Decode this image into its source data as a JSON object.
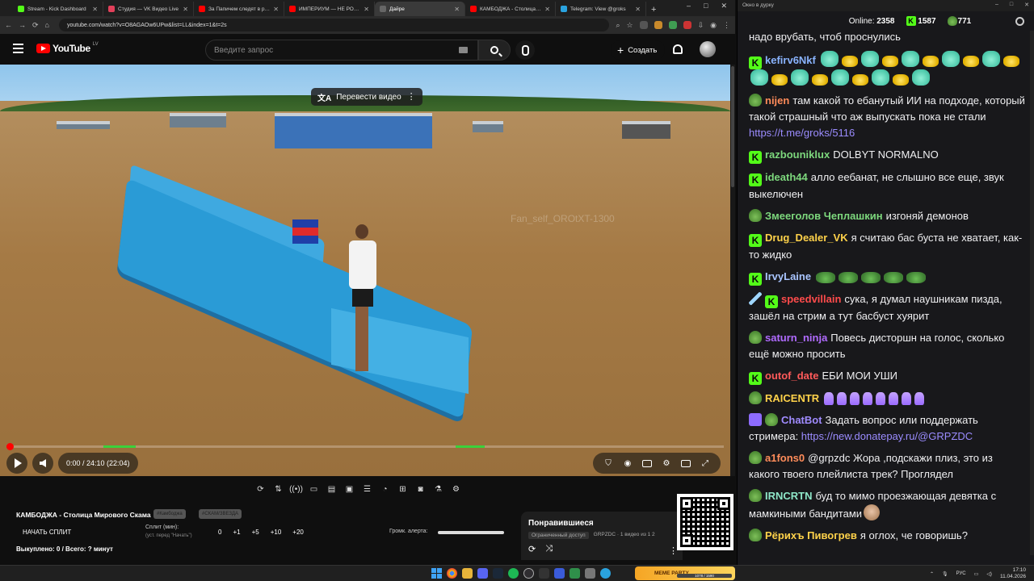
{
  "browser": {
    "tabs": [
      {
        "title": "Stream - Kick Dashboard",
        "color": "#53fc18",
        "active": false
      },
      {
        "title": "Студия — VK Видео Live",
        "color": "#e2405a",
        "active": false
      },
      {
        "title": "За Папичем следят в реальн...",
        "color": "#ff0000",
        "active": false
      },
      {
        "title": "ИМПЕРИУМ — НЕ РОССИЯ",
        "color": "#ff0000",
        "active": false
      },
      {
        "title": "Дайре",
        "color": "#666666",
        "active": true
      },
      {
        "title": "КАМБОДЖА - Столица Мир...",
        "color": "#ff0000",
        "active": false
      },
      {
        "title": "Telegram: View @groks",
        "color": "#2aa3df",
        "active": false
      }
    ],
    "url": "youtube.com/watch?v=O8AGAOw6UPw&list=LL&index=1&t=2s",
    "window_controls": {
      "minimize": "–",
      "maximize": "□",
      "close": "✕"
    }
  },
  "youtube": {
    "logo_text": "YouTube",
    "region": "LV",
    "search_placeholder": "Введите запрос",
    "create_label": "Создать",
    "translate_label": "Перевести видео",
    "watermark": "Fan_self_OROtXT-1300",
    "player": {
      "time": "0:00 / 24:10 (22:04)",
      "progress_fraction": 0.0
    }
  },
  "below": {
    "video_title": "КАМБОДЖА - Столица Мирового Скама",
    "tags": [
      "#Камбоджа",
      "#СКАМ/ЗВЕЗДА"
    ],
    "split_button": "НАЧАТЬ СПЛИТ",
    "split_label": "Сплит (мин):",
    "split_hint": "(уст. перед \"Начать\")",
    "split_values": [
      "0",
      "+1",
      "+5",
      "+10",
      "+20"
    ],
    "alert_label": "Громк. алерта:",
    "bought": "Выкуплено: 0 / Всего: ? минут",
    "playlist": {
      "title": "Понравившиеся",
      "access": "Ограниченный доступ",
      "meta": "GRPZDC · 1 видео из 1 2"
    }
  },
  "chat": {
    "window_title": "Окно в дурку",
    "online_label": "Online:",
    "online_count": "2358",
    "kick_count": "1587",
    "other_count": "771",
    "messages": [
      {
        "user": "",
        "color": "#efeff1",
        "badges": [],
        "text": "надо врубать, чтоб проснулись"
      },
      {
        "user": "kefirv6Nkf",
        "color": "#8ab4ff",
        "badges": [
          "k"
        ],
        "text": "",
        "emotes": "kefir"
      },
      {
        "user": "nijen",
        "color": "#ff8c5a",
        "badges": [
          "frog"
        ],
        "text": "там какой то ебанутый ИИ на подходе, который такой страшный что аж выпускать пока не стали ",
        "link": "https://t.me/groks/5116"
      },
      {
        "user": "razbouniklux",
        "color": "#7dd87d",
        "badges": [
          "k"
        ],
        "text": "DOLBYT NORMALNO"
      },
      {
        "user": "ideath44",
        "color": "#7dd87d",
        "badges": [
          "k"
        ],
        "text": "алло еебанат, не слышно все еще, звук выкелючен"
      },
      {
        "user": "Змееголов Чеплашкин",
        "color": "#7dd87d",
        "badges": [
          "frog"
        ],
        "text": "изгоняй демонов"
      },
      {
        "user": "Drug_Dealer_VK",
        "color": "#ffd24a",
        "badges": [
          "k"
        ],
        "text": "я считаю бас буста не хватает, как-то жидко"
      },
      {
        "user": "IrvyLaine",
        "color": "#a9c5ff",
        "badges": [
          "k"
        ],
        "text": "",
        "emotes": "frogs"
      },
      {
        "user": "speedvillain",
        "color": "#ff4b4b",
        "badges": [
          "sword",
          "k"
        ],
        "text": "сука, я думал наушникам пизда, зашёл на стрим а тут басбуст хуярит"
      },
      {
        "user": "saturn_ninja",
        "color": "#b06bff",
        "badges": [
          "frog"
        ],
        "text": "Повесь дисторшн на голос, сколько ещё можно просить"
      },
      {
        "user": "outof_date",
        "color": "#ff5a5a",
        "badges": [
          "k"
        ],
        "text": "ЕБИ МОИ УШИ"
      },
      {
        "user": "RAICENTR",
        "color": "#ffd24a",
        "badges": [
          "frog"
        ],
        "text": "",
        "emotes": "sil"
      },
      {
        "user": "ChatBot",
        "color": "#a08bff",
        "badges": [
          "bot",
          "frog"
        ],
        "text": "Задать вопрос или поддержать стримера: ",
        "link": "https://new.donatepay.ru/@GRPZDC"
      },
      {
        "user": "a1fons0",
        "color": "#ff8c5a",
        "badges": [
          "frog"
        ],
        "text": "@grpzdc Жора ,подскажи плиз, это из какого твоего плейлиста трек? Проглядел"
      },
      {
        "user": "IRNCRTN",
        "color": "#8ee6c8",
        "badges": [
          "frog"
        ],
        "text": "буд то мимо проезжающая девятка с мамкиными бандитами",
        "face": true
      },
      {
        "user": "Рёрихъ Пивогрев",
        "color": "#ffd24a",
        "badges": [
          "frog"
        ],
        "text": "я оглох, че говоришь?"
      }
    ]
  },
  "taskbar": {
    "meme_label": "MEME PARTY",
    "meme_progress": "1078 / 1590",
    "lang": "РУС",
    "time": "17:10",
    "date": "11.04.2026"
  },
  "colors": {
    "accent_red": "#ff0000",
    "kick_green": "#53fc18",
    "chapter_green": "#3bd13b"
  }
}
